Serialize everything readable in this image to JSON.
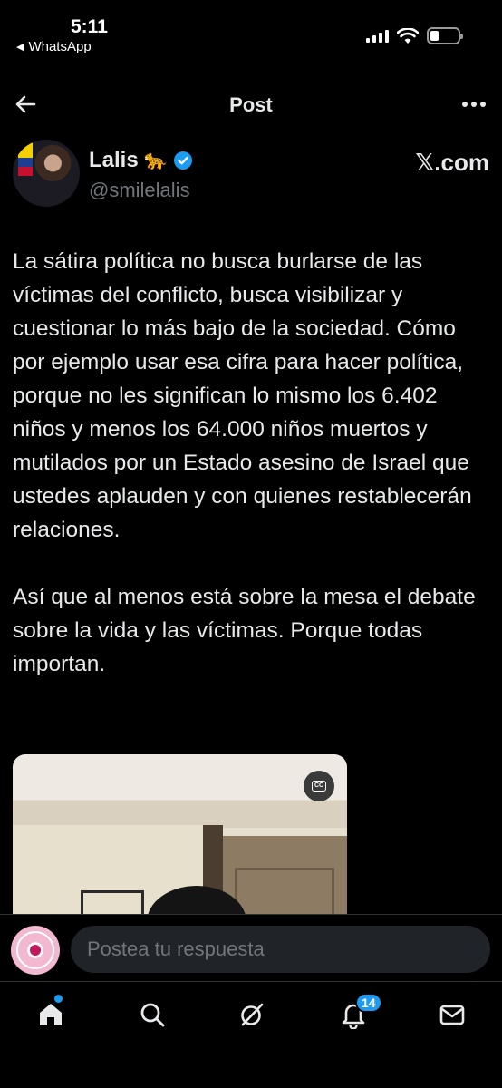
{
  "status_bar": {
    "time": "5:11",
    "back_app": "WhatsApp",
    "battery_level": 0.3
  },
  "header": {
    "title": "Post"
  },
  "author": {
    "name": "Lalis",
    "emoji": "🐆",
    "handle": "@smilelalis",
    "source": "𝕏.com"
  },
  "post": {
    "text": "La sátira política no busca burlarse de las víctimas del conflicto, busca visibilizar y cuestionar lo más bajo de la sociedad. Cómo por ejemplo usar esa cifra para hacer política, porque no les significan lo mismo los 6.402 niños y menos los 64.000 niños muertos y mutilados por un Estado asesino de Israel que ustedes aplauden y con quienes restablecerán relaciones.\n\nAsí que al menos está sobre la mesa el debate sobre la vida y las víctimas. Porque todas importan."
  },
  "video": {
    "cc_icon": "closed-captions-icon"
  },
  "reply": {
    "placeholder": "Postea tu respuesta"
  },
  "nav": {
    "items": [
      "home-icon",
      "search-icon",
      "grok-icon",
      "notifications-icon",
      "messages-icon"
    ],
    "notifications_count": "14",
    "accent_color": "#1d9bf0"
  }
}
